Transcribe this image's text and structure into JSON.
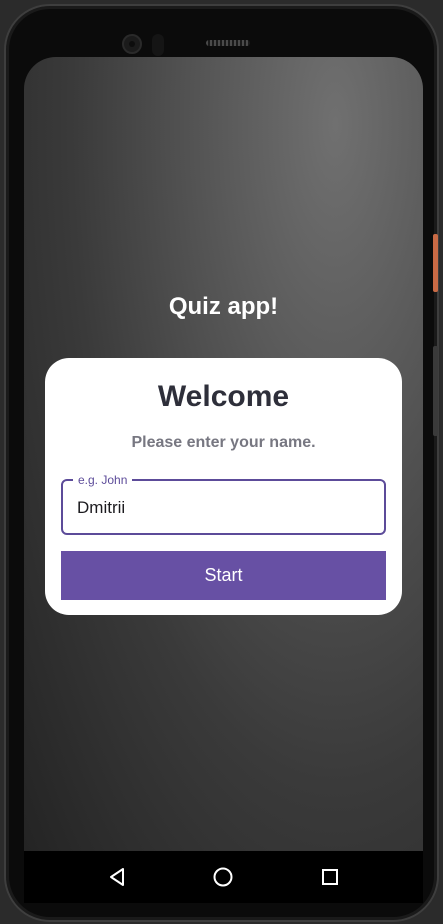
{
  "app": {
    "title": "Quiz app!"
  },
  "card": {
    "heading": "Welcome",
    "subtitle": "Please enter your name.",
    "name_field": {
      "label": "e.g. John",
      "value": "Dmitrii"
    },
    "start_label": "Start"
  },
  "navbar": {
    "back": "back-icon",
    "home": "home-icon",
    "recents": "recents-icon"
  },
  "colors": {
    "accent": "#6750a4",
    "outline": "#5c4b99",
    "heading": "#2e2f3a",
    "subtitle": "#777781"
  }
}
